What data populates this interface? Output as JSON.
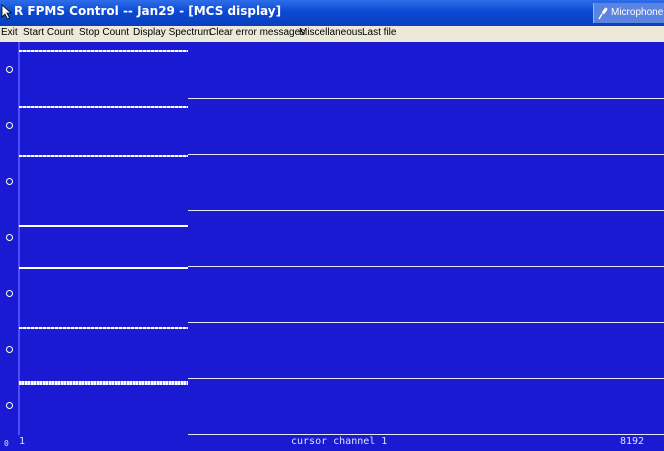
{
  "window": {
    "title": "R FPMS Control -- Jan29 - [MCS display]",
    "microphone_label": "Microphone"
  },
  "menu": {
    "items": [
      "Exit",
      "Start Count",
      "Stop Count",
      "Display Spectrum",
      "Clear error messages",
      "Miscellaneous",
      "Last file"
    ]
  },
  "display": {
    "background_color": "#1a1ad2",
    "trace_color": "#ffffff",
    "panel_count": 7,
    "footer": {
      "left_marker": "0",
      "start_channel": "1",
      "cursor_text": "cursor channel 1",
      "end_channel": "8192"
    }
  },
  "icons": [
    "app-icon",
    "microphone-icon"
  ]
}
